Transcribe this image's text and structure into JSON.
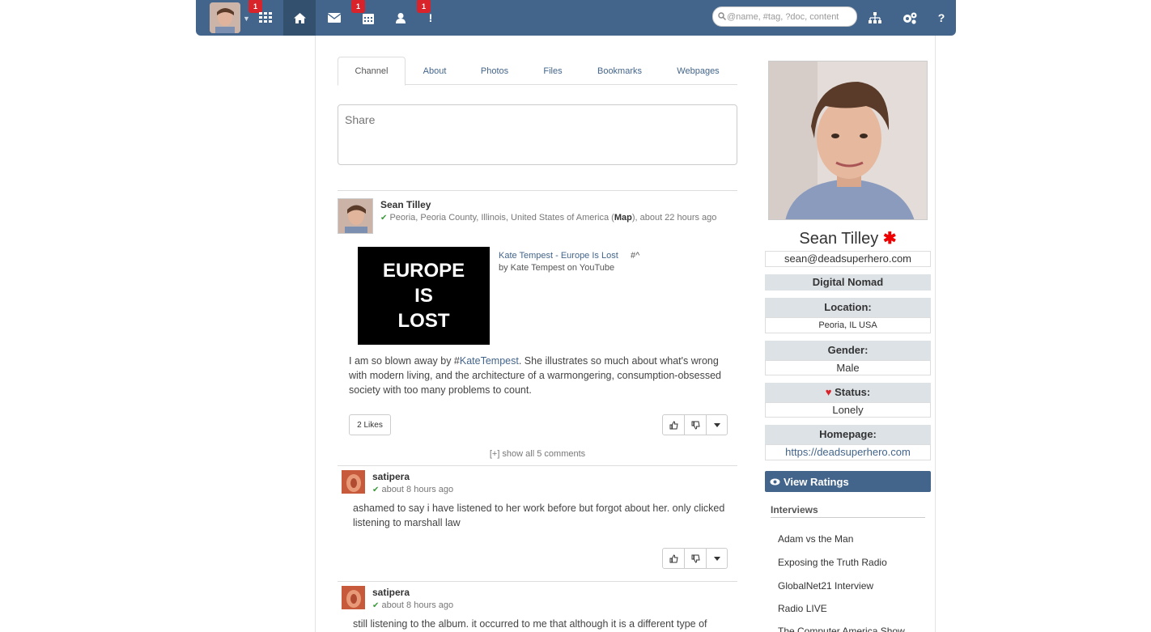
{
  "nav": {
    "badges": {
      "apps": "1",
      "mail": "1",
      "notify": "1"
    },
    "search_placeholder": "@name, #tag, ?doc, content"
  },
  "tabs": [
    {
      "label": "Channel"
    },
    {
      "label": "About"
    },
    {
      "label": "Photos"
    },
    {
      "label": "Files"
    },
    {
      "label": "Bookmarks"
    },
    {
      "label": "Webpages"
    }
  ],
  "share": {
    "placeholder": "Share"
  },
  "post": {
    "author": "Sean Tilley",
    "location": "Peoria, Peoria County, Illinois, United States of America (",
    "map_label": "Map",
    "time": "), about 22 hours ago",
    "video_thumb_lines": [
      "EUROPE",
      "IS",
      "LOST"
    ],
    "video_title": "Kate Tempest - Europe Is Lost",
    "video_hash": "#^",
    "video_by": "by Kate Tempest on YouTube",
    "body_pre": "I am so blown away by #",
    "hashtag": "KateTempest",
    "body_post": ". She illustrates so much about what's wrong with modern living, and the architecture of a warmongering, consumption-obsessed society with too many problems to count.",
    "likes": "2 Likes",
    "show_comments": "[+] show all 5 comments"
  },
  "comments": [
    {
      "author": "satipera",
      "time": "about 8 hours ago",
      "text": "ashamed to say i have listened to her work before but forgot about her. only clicked listening to marshall law"
    },
    {
      "author": "satipera",
      "time": "about 8 hours ago",
      "text": "still listening to the album. it occurred to me that although it is a different type of"
    }
  ],
  "profile": {
    "name": "Sean Tilley",
    "email": "sean@deadsuperhero.com",
    "title": "Digital Nomad",
    "location_label": "Location:",
    "location": "Peoria, IL USA",
    "gender_label": "Gender:",
    "gender": "Male",
    "status_label": "Status:",
    "status": "Lonely",
    "homepage_label": "Homepage:",
    "homepage": "https://deadsuperhero.com",
    "ratings_button": "View Ratings"
  },
  "interviews": {
    "title": "Interviews",
    "items": [
      "Adam vs the Man",
      "Exposing the Truth Radio",
      "GlobalNet21 Interview",
      "Radio LIVE",
      "The Computer America Show"
    ]
  },
  "colors": {
    "navbar": "#43658b",
    "accent_red": "#d9232a"
  }
}
